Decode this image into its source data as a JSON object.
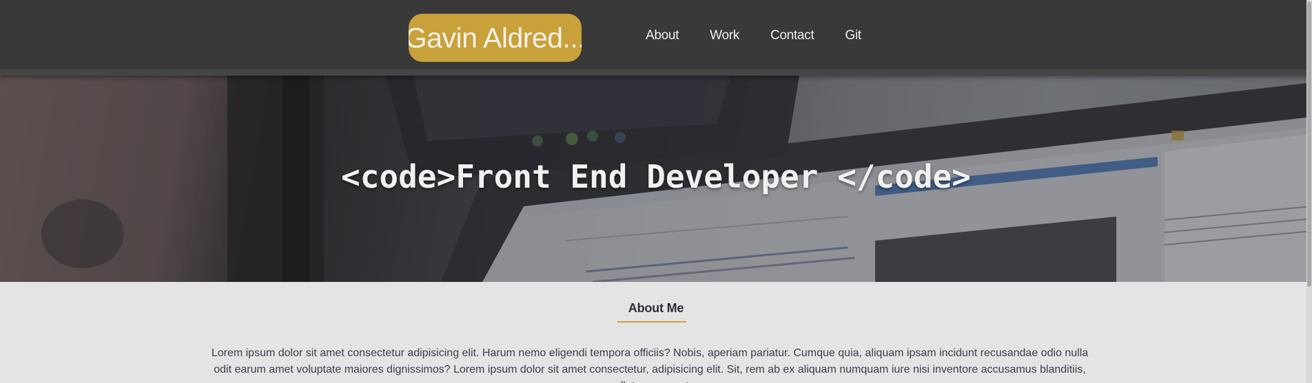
{
  "navbar": {
    "brand": "Gavin Aldred...",
    "links": [
      {
        "label": "About"
      },
      {
        "label": "Work"
      },
      {
        "label": "Contact"
      },
      {
        "label": "Git"
      }
    ]
  },
  "hero": {
    "title": "<code>Front End Developer </code>"
  },
  "about": {
    "heading": "About Me",
    "text": "Lorem ipsum dolor sit amet consectetur adipisicing elit. Harum nemo eligendi tempora officiis? Nobis, aperiam pariatur. Cumque quia, aliquam ipsam incidunt recusandae odio nulla odit earum amet voluptate maiores dignissimos? Lorem ipsum dolor sit amet consectetur, adipisicing elit. Sit, rem ab ex aliquam numquam iure nisi inventore accusamus blanditiis, repellat consequatur,"
  },
  "colors": {
    "navbar_bg": "#393939",
    "brand_accent": "#c9a13a",
    "page_bg": "#e4e4e4",
    "heading_text": "#2a2f3a"
  }
}
